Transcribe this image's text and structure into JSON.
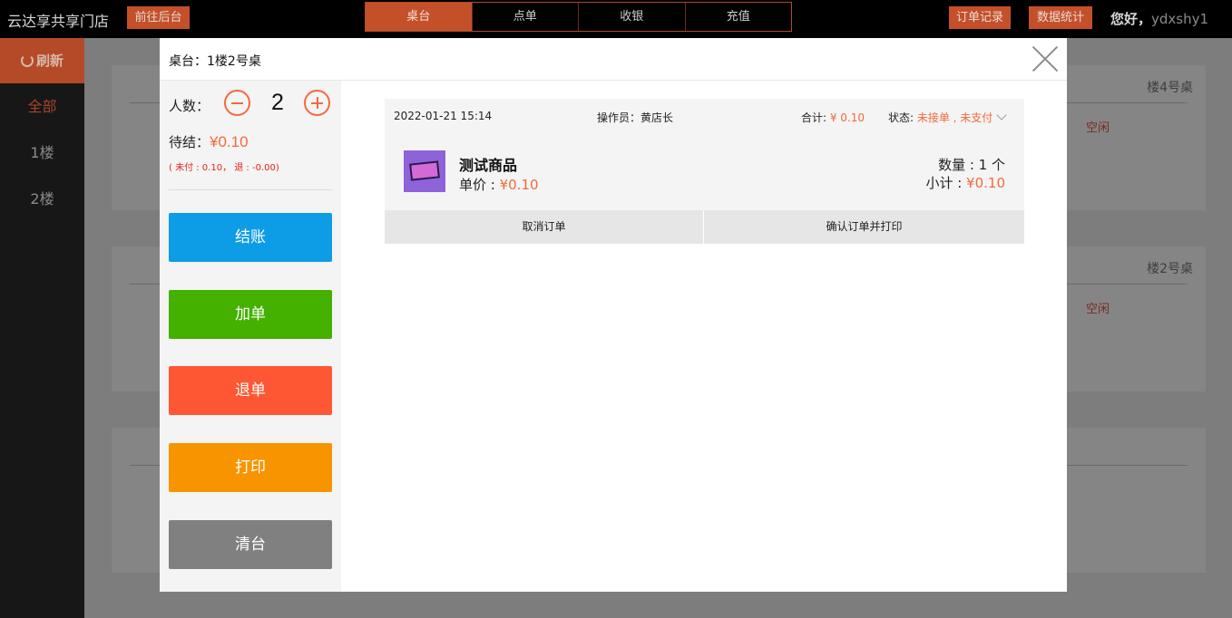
{
  "header": {
    "brand": "云达享共享门店",
    "goto_admin": "前往后台",
    "nav": [
      "桌台",
      "点单",
      "收银",
      "充值"
    ],
    "order_records": "订单记录",
    "data_stats": "数据统计",
    "greeting": "您好，",
    "username": "ydxshy1"
  },
  "sidebar": {
    "refresh": "刷新",
    "items": [
      "全部",
      "1楼",
      "2楼"
    ]
  },
  "background_cards": [
    {
      "title": "楼4号桌",
      "status": "空闲"
    },
    {
      "title": "楼2号桌",
      "status": "空闲"
    },
    {
      "title": "",
      "status": ""
    }
  ],
  "modal": {
    "title": "桌台：1楼2号桌",
    "people_label": "人数：",
    "people_count": "2",
    "pending_label": "待结：",
    "pending_amount": "¥0.10",
    "pending_detail": "( 未付 : 0.10， 退 : -0.00)",
    "buttons": {
      "checkout": "结账",
      "add": "加单",
      "refund": "退单",
      "print": "打印",
      "clear": "清台"
    },
    "order": {
      "time": "2022-01-21 15:14",
      "operator_label": "操作员：",
      "operator": "黄店长",
      "total_label": "合计: ",
      "total": "¥ 0.10",
      "status_label": "状态: ",
      "status": "未接单 , 未支付",
      "product_name": "测试商品",
      "unit_price_label": "单价 : ",
      "unit_price": "¥0.10",
      "quantity": "数量 : 1 个",
      "subtotal_label": "小计 : ",
      "subtotal": "¥0.10",
      "cancel": "取消订单",
      "confirm_print": "确认订单并打印"
    }
  },
  "colors": {
    "accent": "#c4502a",
    "price": "#f26a3c",
    "checkout": "#0d9ce6",
    "add": "#44b000",
    "refund": "#fe5734",
    "print": "#f79400",
    "clear": "#808080"
  }
}
